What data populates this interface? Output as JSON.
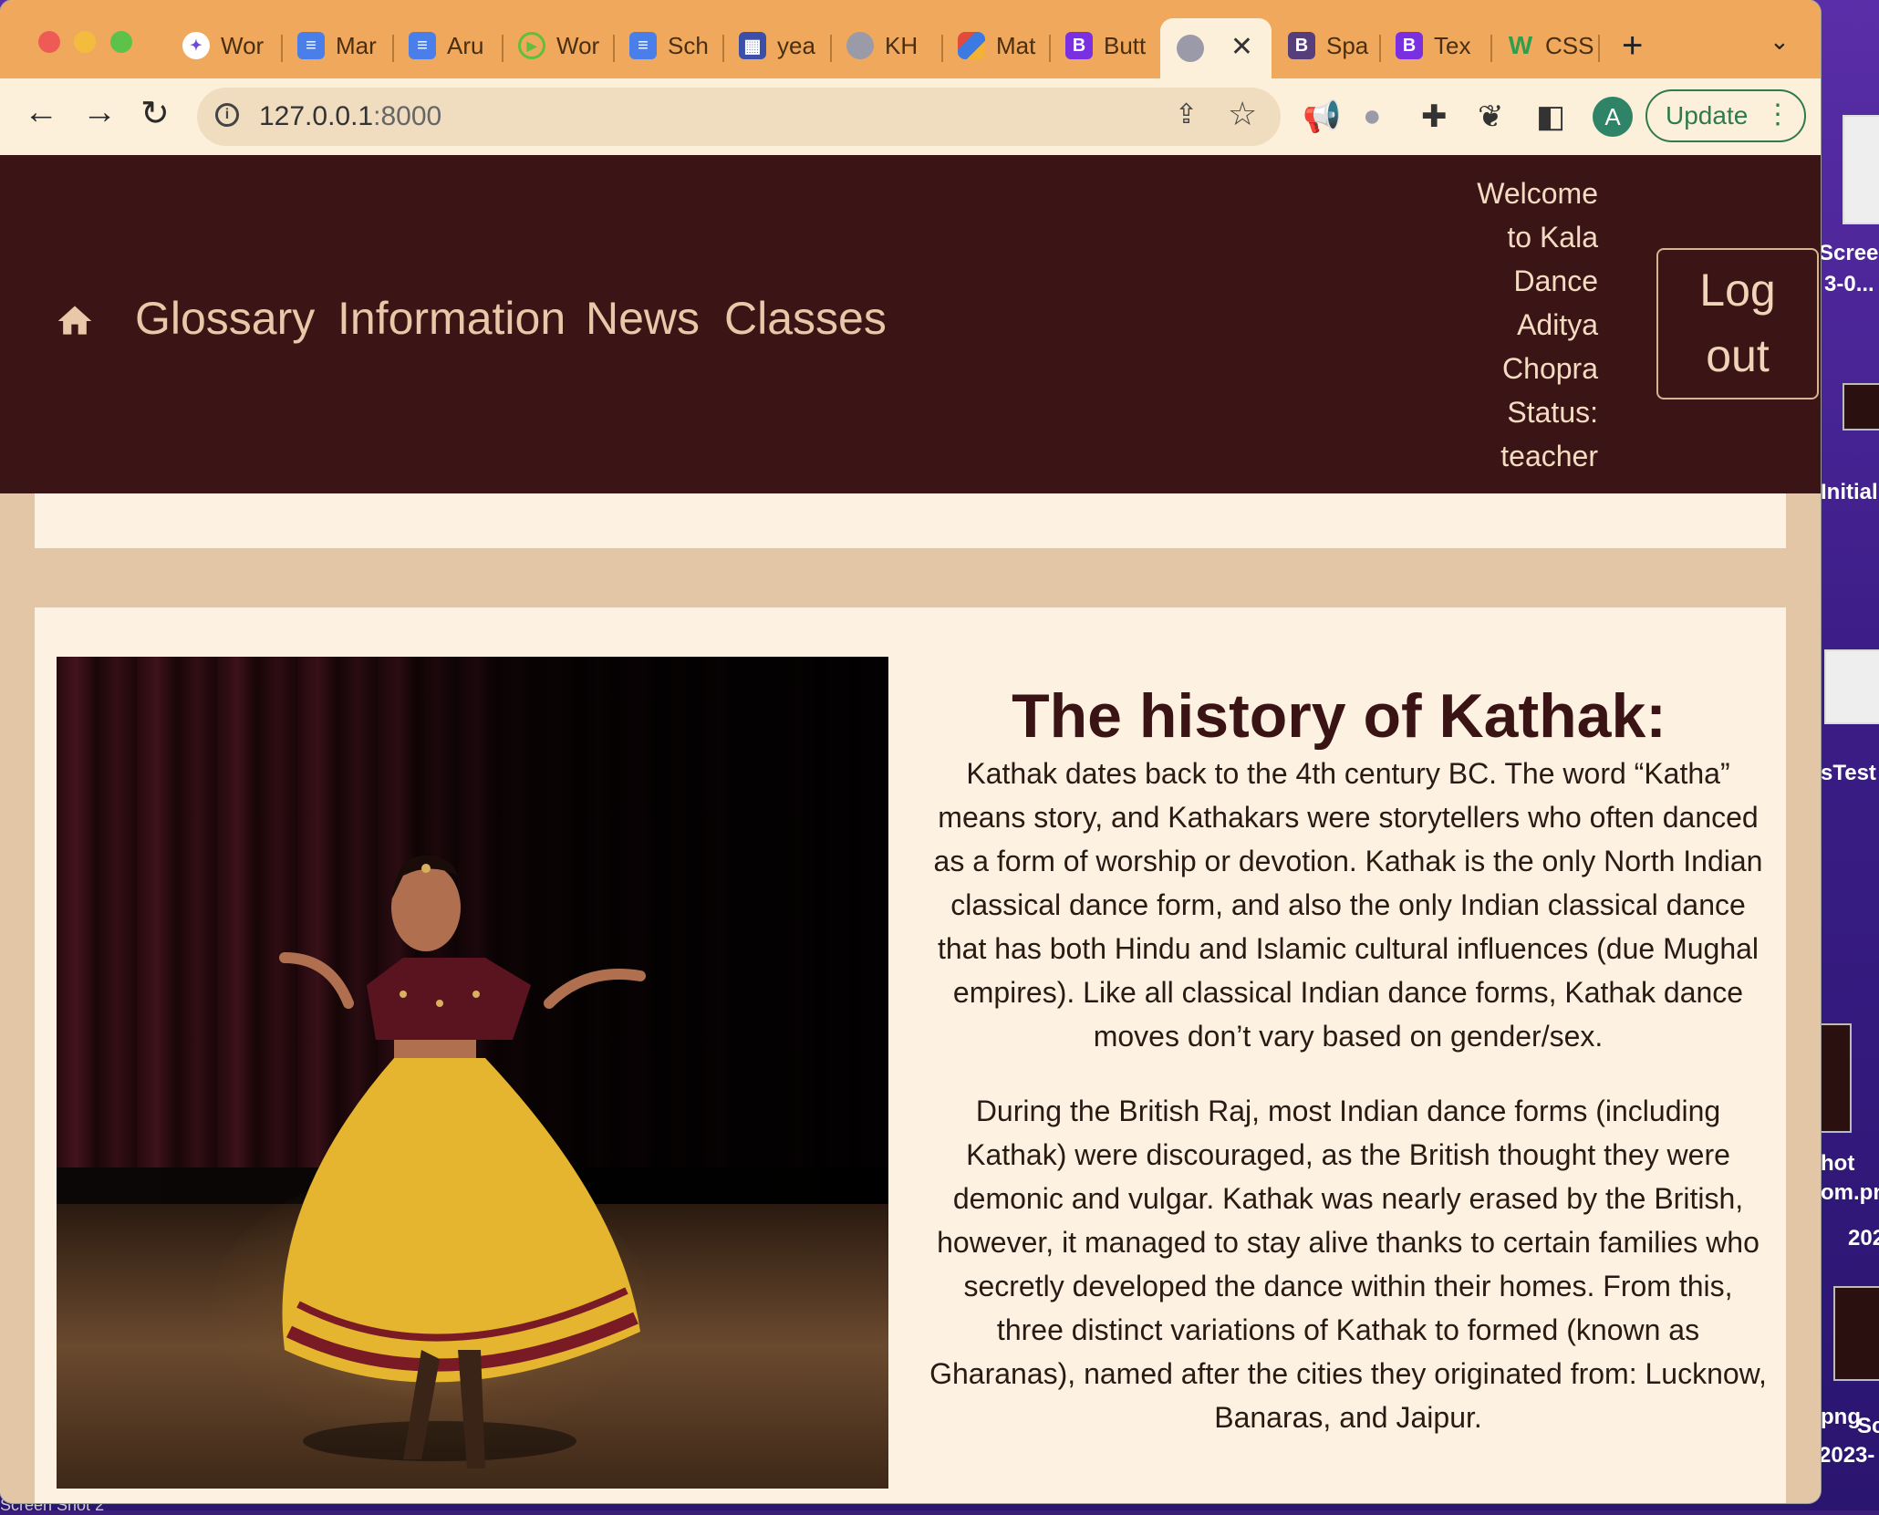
{
  "desktop": {
    "labels": [
      "Scree",
      "3-0...",
      "Initial",
      "sTest",
      "hot",
      "om.pn",
      "202",
      "png",
      "Sc",
      "2023-"
    ],
    "bottom_label": "Screen Shot 2"
  },
  "browser": {
    "tabs": [
      {
        "label": "Wor",
        "icon": "wordtune-icon",
        "color": "#ffffff"
      },
      {
        "label": "Mar",
        "icon": "google-docs-icon",
        "color": "#4a7ee8"
      },
      {
        "label": "Aru",
        "icon": "google-docs-icon",
        "color": "#4a7ee8"
      },
      {
        "label": "Wor",
        "icon": "play-circle-icon",
        "color": "#5fbf3f"
      },
      {
        "label": "Sch",
        "icon": "google-docs-icon",
        "color": "#4a7ee8"
      },
      {
        "label": "yea",
        "icon": "calendar-grid-icon",
        "color": "#3b4fa8"
      },
      {
        "label": "KH",
        "icon": "globe-icon",
        "color": "#9a9aa8"
      },
      {
        "label": "Mat",
        "icon": "multicolor-logo-icon",
        "color": "#e24a3b"
      },
      {
        "label": "Butt",
        "icon": "bootstrap-icon",
        "color": "#7a2fe0"
      },
      {
        "label": "",
        "icon": "globe-icon",
        "color": "#9a9aa8",
        "active": true
      },
      {
        "label": "Spa",
        "icon": "bootstrap-icon",
        "color": "#563d7c"
      },
      {
        "label": "Tex",
        "icon": "bootstrap-icon",
        "color": "#7a2fe0"
      },
      {
        "label": "CSS",
        "icon": "w3schools-icon",
        "color": "#2e9e4f"
      }
    ],
    "bootstrap_letter": "B",
    "w3_letter": "W",
    "new_tab_symbol": "+",
    "tab_list_symbol": "⌄",
    "close_symbol": "✕",
    "url_host": "127.0.0.1",
    "url_port": ":8000",
    "avatar_letter": "A",
    "update_label": "Update",
    "menu_dots": "⋮"
  },
  "site": {
    "nav_links": [
      "Glossary",
      "Information",
      "News",
      "Classes"
    ],
    "welcome_lines": [
      "Welcome",
      "to Kala",
      "Dance",
      "Aditya",
      "Chopra",
      "Status:",
      "teacher"
    ],
    "logout_lines": [
      "Log",
      "out"
    ]
  },
  "article": {
    "title": "The history of Kathak:",
    "paragraph1": "Kathak dates back to the 4th century BC. The word “Katha” means story, and Kathakars were storytellers who often danced as a form of worship or devotion. Kathak is the only North Indian classical dance form, and also the only Indian classical dance that has both Hindu and Islamic cultural influences (due Mughal empires). Like all classical Indian dance forms, Kathak dance moves don’t vary based on gender/sex.",
    "paragraph2": "During the British Raj, most Indian dance forms (including Kathak) were discouraged, as the British thought they were demonic and vulgar. Kathak was nearly erased by the British, however, it managed to stay alive thanks to certain families who secretly developed the dance within their homes. From this, three distinct variations of Kathak to formed (known as Gharanas), named after the cities they originated from: Lucknow, Banaras, and Jaipur."
  }
}
